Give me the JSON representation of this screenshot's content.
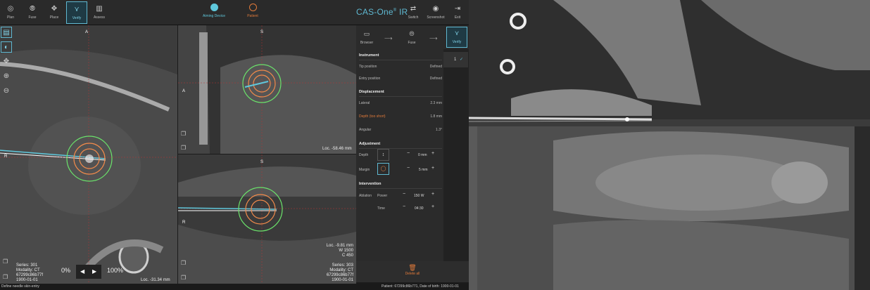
{
  "toolbar": {
    "items": [
      {
        "label": "Plan",
        "icon": "plan-icon"
      },
      {
        "label": "Fuse",
        "icon": "fuse-icon"
      },
      {
        "label": "Place",
        "icon": "place-icon"
      },
      {
        "label": "Verify",
        "icon": "verify-icon",
        "active": true
      },
      {
        "label": "Assess",
        "icon": "assess-icon"
      }
    ],
    "modes": [
      {
        "label": "Aiming Device",
        "color": "#5fc8dc"
      },
      {
        "label": "Patient",
        "color": "#e07a3a"
      }
    ],
    "brand": "CAS-One",
    "brand_suffix": "IR",
    "actions": [
      {
        "label": "Switch",
        "icon": "switch-icon"
      },
      {
        "label": "Screenshot",
        "icon": "camera-icon"
      },
      {
        "label": "Exit",
        "icon": "exit-icon"
      }
    ]
  },
  "views": {
    "axial": {
      "orient_top": "A",
      "orient_left": "R",
      "info": [
        "Series: 301",
        "Modality: CT",
        "67299c86b77f",
        "1900-01-01"
      ],
      "loc": "Loc. -31.34 mm",
      "zoom_min": "0%",
      "zoom_max": "100%"
    },
    "sagittal": {
      "orient_top": "S",
      "orient_left": "A",
      "loc": "Loc. -58.46 mm"
    },
    "coronal": {
      "orient_top": "S",
      "orient_left": "R",
      "loc": [
        "Loc. -9.81 mm",
        "W 1500",
        "C 450"
      ],
      "info": [
        "Series: 303",
        "Modality: CT",
        "67299c86b77f",
        "1900-01-01"
      ]
    }
  },
  "workflow": {
    "items": [
      {
        "label": "Browser",
        "icon": "folder-icon"
      },
      {
        "label": "Fuse",
        "icon": "fuse-icon"
      },
      {
        "label": "Verify",
        "icon": "verify-icon",
        "active": true
      }
    ],
    "check_number": "1"
  },
  "panel": {
    "instrument_title": "Instrument",
    "tip_label": "Tip position",
    "tip_value": "Defined",
    "entry_label": "Entry position",
    "entry_value": "Defined",
    "displacement_title": "Displacement",
    "lateral_label": "Lateral",
    "lateral_value": "2.3 mm",
    "depth_label": "Depth (too short)",
    "depth_value": "1.8 mm",
    "angular_label": "Angular",
    "angular_value": "1.3°",
    "adjustment_title": "Adjustment",
    "adj_depth_label": "Depth",
    "adj_depth_value": "0 mm",
    "margin_label": "Margin",
    "margin_value": "5 mm",
    "intervention_title": "Intervention",
    "ablation_label": "Ablation",
    "power_label": "Power",
    "power_value": "150 W",
    "time_label": "Time",
    "time_value": "04:30",
    "delete_label": "Delete all"
  },
  "status": {
    "left": "Define needle skin-entry",
    "right": "Patient: 67299c86b771, Date of birth: 1900-01-01"
  },
  "colors": {
    "accent": "#5fb8d1",
    "warning": "#e07a3a",
    "ring_green": "#6be36b",
    "ring_orange": "#f08a4b"
  }
}
